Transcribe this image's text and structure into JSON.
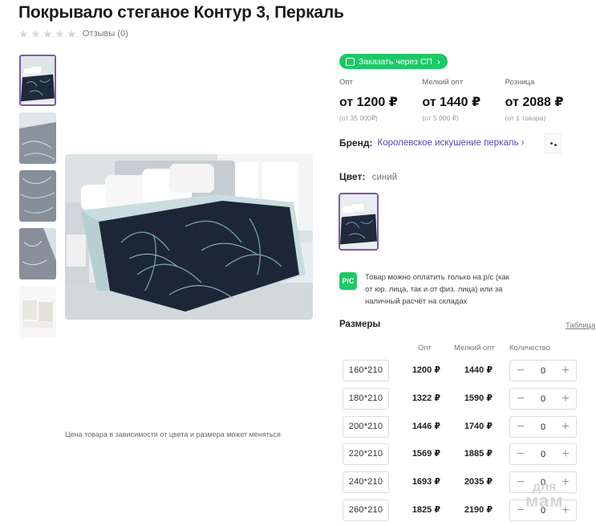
{
  "product": {
    "title": "Покрывало стеганое Контур 3, Перкаль",
    "reviews": "Отзывы (0)"
  },
  "gallery": {
    "note": "Цена товара в зависимости от цвета и размера может меняться"
  },
  "order_button": {
    "label": "Заказать через СП",
    "accent": "#1ec866"
  },
  "prices": [
    {
      "label": "Опт",
      "value": "от 1200 ₽",
      "min": "(от 35 000₽)"
    },
    {
      "label": "Мелкий опт",
      "value": "от 1440 ₽",
      "min": "(от 5 000 ₽)"
    },
    {
      "label": "Розница",
      "value": "от 2088 ₽",
      "min": "(от 1 товара)"
    }
  ],
  "brand": {
    "label": "Бренд:",
    "name": "Королевское искушение перкаль"
  },
  "color": {
    "label": "Цвет:",
    "value": "синий"
  },
  "payment": {
    "icon_text": "Р/С",
    "text": "Товар можно оплатить только на р/с (как от юр. лица, так и от физ. лица) или за наличный расчёт на складах"
  },
  "sizes": {
    "title": "Размеры",
    "table_link": "Таблица",
    "headers": {
      "opt": "Опт",
      "small": "Мелкий опт",
      "qty": "Количество"
    },
    "rows": [
      {
        "size": "160*210",
        "opt": "1200 ₽",
        "small": "1440 ₽",
        "qty": "0"
      },
      {
        "size": "180*210",
        "opt": "1322 ₽",
        "small": "1590 ₽",
        "qty": "0"
      },
      {
        "size": "200*210",
        "opt": "1446 ₽",
        "small": "1740 ₽",
        "qty": "0"
      },
      {
        "size": "220*210",
        "opt": "1569 ₽",
        "small": "1885 ₽",
        "qty": "0"
      },
      {
        "size": "240*210",
        "opt": "1693 ₽",
        "small": "2035 ₽",
        "qty": "0"
      },
      {
        "size": "260*210",
        "opt": "1825 ₽",
        "small": "2190 ₽",
        "qty": "0"
      }
    ]
  },
  "watermark": {
    "line1": "для",
    "line2": "мам"
  }
}
